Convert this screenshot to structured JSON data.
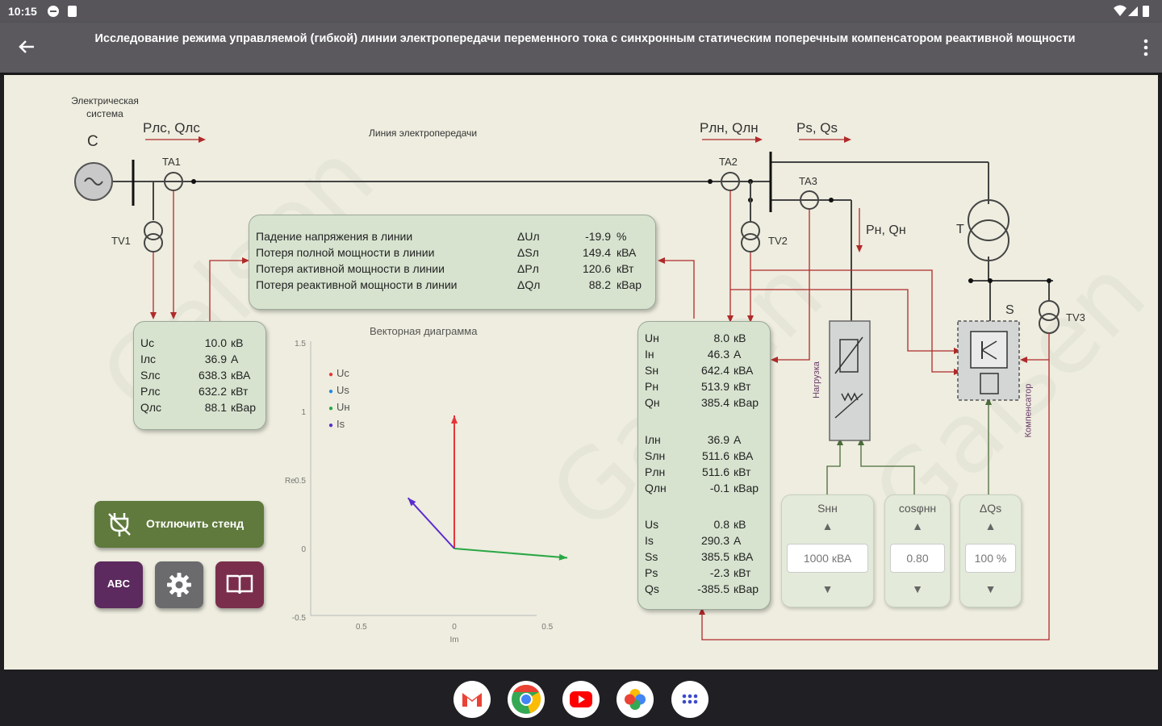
{
  "status_bar": {
    "time": "10:15"
  },
  "app_bar": {
    "title": "Исследование режима управляемой (гибкой) линии электропередачи переменного тока с синхронным статическим поперечным компенсатором реактивной мощности"
  },
  "schema": {
    "system_label": "Электрическая система",
    "source_label": "C",
    "pc_label": "Pлс, Qлс",
    "line_label": "Линия электропередачи",
    "pn_label": "Pлн, Qлн",
    "ps_label": "Ps, Qs",
    "load_flow_label": "Pн, Qн",
    "ta1": "TA1",
    "ta2": "TA2",
    "ta3": "TA3",
    "tv1": "TV1",
    "tv2": "TV2",
    "tv3": "TV3",
    "t_label": "T",
    "s_label": "S",
    "load_label": "Нагрузка",
    "comp_label": "Компенсатор"
  },
  "losses_box": {
    "rows": [
      {
        "name": "Падение напряжения в линии",
        "sym": "ΔUл",
        "val": "-19.9",
        "unit": "%"
      },
      {
        "name": "Потеря полной мощности в линии",
        "sym": "ΔSл",
        "val": "149.4",
        "unit": "кВА"
      },
      {
        "name": "Потеря активной мощности в линии",
        "sym": "ΔPл",
        "val": "120.6",
        "unit": "кВт"
      },
      {
        "name": "Потеря реактивной мощности в линии",
        "sym": "ΔQл",
        "val": "88.2",
        "unit": "кВар"
      }
    ]
  },
  "source_box": {
    "rows": [
      {
        "sym": "Uс",
        "val": "10.0",
        "unit": "кВ"
      },
      {
        "sym": "Iлс",
        "val": "36.9",
        "unit": "А"
      },
      {
        "sym": "Sлс",
        "val": "638.3",
        "unit": "кВА"
      },
      {
        "sym": "Pлс",
        "val": "632.2",
        "unit": "кВт"
      },
      {
        "sym": "Qлс",
        "val": "88.1",
        "unit": "кВар"
      }
    ]
  },
  "receiver_box": {
    "rows": [
      {
        "sym": "Uн",
        "val": "8.0",
        "unit": "кВ"
      },
      {
        "sym": "Iн",
        "val": "46.3",
        "unit": "А"
      },
      {
        "sym": "Sн",
        "val": "642.4",
        "unit": "кВА"
      },
      {
        "sym": "Pн",
        "val": "513.9",
        "unit": "кВт"
      },
      {
        "sym": "Qн",
        "val": "385.4",
        "unit": "кВар"
      },
      {
        "sym": "Iлн",
        "val": "36.9",
        "unit": "А"
      },
      {
        "sym": "Sлн",
        "val": "511.6",
        "unit": "кВА"
      },
      {
        "sym": "Pлн",
        "val": "511.6",
        "unit": "кВт"
      },
      {
        "sym": "Qлн",
        "val": "-0.1",
        "unit": "кВар"
      },
      {
        "sym": "Us",
        "val": "0.8",
        "unit": "кВ"
      },
      {
        "sym": "Is",
        "val": "290.3",
        "unit": "А"
      },
      {
        "sym": "Ss",
        "val": "385.5",
        "unit": "кВА"
      },
      {
        "sym": "Ps",
        "val": "-2.3",
        "unit": "кВт"
      },
      {
        "sym": "Qs",
        "val": "-385.5",
        "unit": "кВар"
      }
    ]
  },
  "controls": [
    {
      "title": "Sнн",
      "value": "1000 кВА"
    },
    {
      "title": "cosφнн",
      "value": "0.80"
    },
    {
      "title": "ΔQs",
      "value": "100 %"
    }
  ],
  "buttons": {
    "disconnect_label": "Отключить стенд",
    "abc_label": "ABC",
    "disconnect_color": "#5f7a3c",
    "abc_color": "#5c2a5e",
    "settings_color": "#6b6b6e",
    "manual_color": "#7a2e4c"
  },
  "chart_data": {
    "type": "vector",
    "title": "Векторная диаграмма",
    "xlabel": "Im",
    "ylabel": "Re",
    "xlim": [
      -1,
      1
    ],
    "ylim": [
      -0.5,
      1.5
    ],
    "x_ticks": [
      "0.5",
      "0",
      "0.5"
    ],
    "y_ticks": [
      "1.5",
      "1",
      "0.5",
      "0",
      "-0.5"
    ],
    "series": [
      {
        "name": "Uс",
        "color": "#e8343a",
        "x": 0,
        "y": 1.0
      },
      {
        "name": "Us",
        "color": "#1e88e5",
        "x": 0.0,
        "y": 0.0
      },
      {
        "name": "Uн",
        "color": "#29a745",
        "x": 0.83,
        "y": -0.07
      },
      {
        "name": "Is",
        "color": "#5b2bcf",
        "x": -0.34,
        "y": 0.38
      }
    ]
  },
  "dock": {
    "apps": [
      "gmail-icon",
      "chrome-icon",
      "youtube-icon",
      "photos-icon",
      "apps-grid-icon"
    ]
  }
}
